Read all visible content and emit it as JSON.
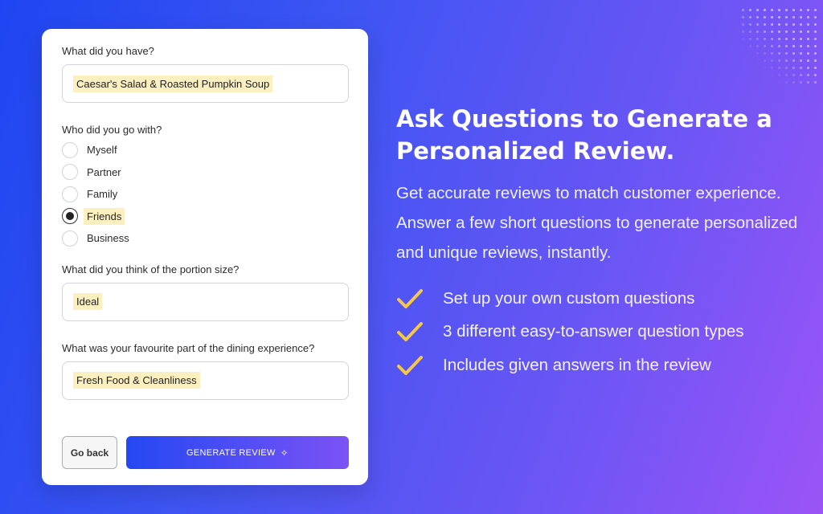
{
  "form": {
    "q1_label": "What did you have?",
    "q1_value": "Caesar's Salad & Roasted Pumpkin Soup",
    "q2_label": "Who did you go with?",
    "q2_options": [
      "Myself",
      "Partner",
      "Family",
      "Friends",
      "Business"
    ],
    "q2_selected": "Friends",
    "q3_label": "What did you think of the portion size?",
    "q3_value": "Ideal",
    "q4_label": "What was your favourite part of the dining experience?",
    "q4_value": "Fresh Food & Cleanliness",
    "back_label": "Go back",
    "generate_label": "GENERATE REVIEW"
  },
  "promo": {
    "headline_line1": "Ask Questions to Generate a",
    "headline_line2": "Personalized Review.",
    "description": "Get accurate reviews to match customer experience. Answer a few short questions to generate personalized and unique reviews, instantly.",
    "features": [
      "Set up your own custom questions",
      "3 different easy-to-answer question types",
      "Includes given answers in the review"
    ]
  },
  "colors": {
    "check": "#f5c84a",
    "highlight": "#fcf0c0",
    "gradient_start": "#1f45f2",
    "gradient_end": "#9b54f6"
  },
  "icons": {
    "check": "check-icon",
    "sparkle": "sparkle-icon",
    "decoration": "dot-grid"
  }
}
